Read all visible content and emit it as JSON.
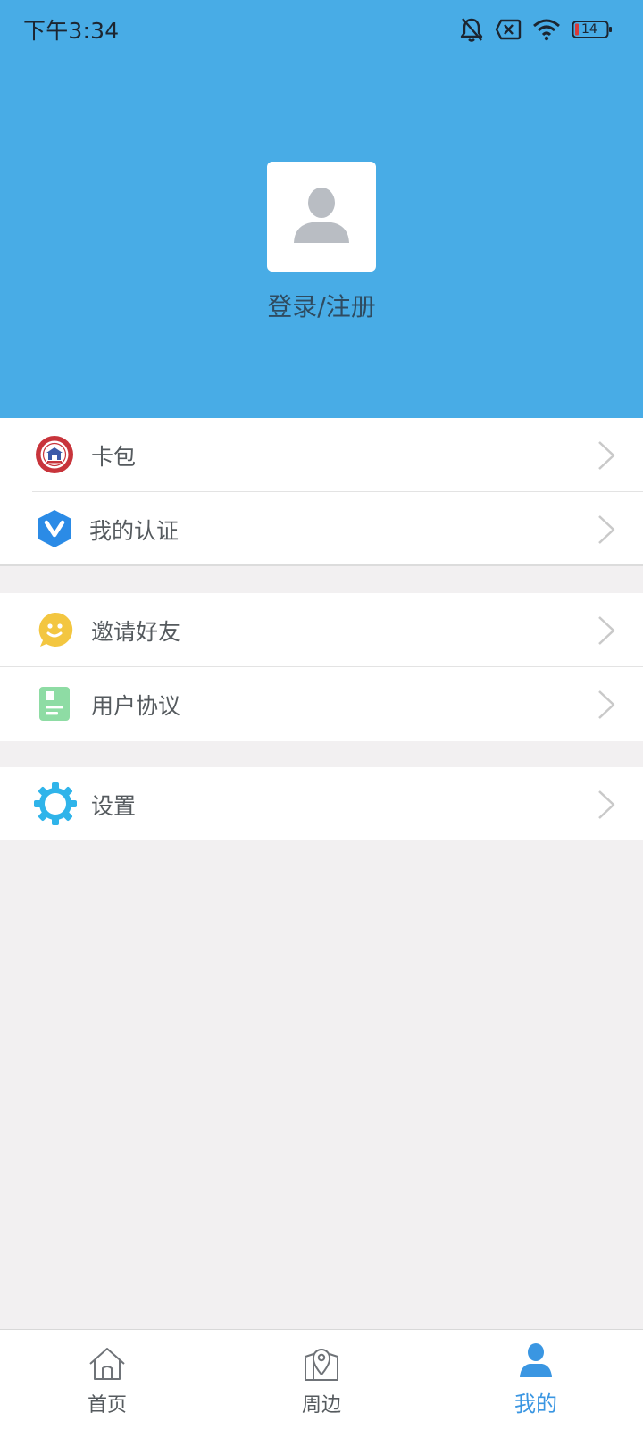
{
  "status_bar": {
    "time": "下午3:34",
    "battery_level": "14",
    "icons": [
      "bell-off-icon",
      "sim-error-icon",
      "wifi-icon",
      "battery-icon"
    ]
  },
  "profile": {
    "avatar_icon": "user-placeholder-icon",
    "login_label": "登录/注册"
  },
  "menu": {
    "group1": [
      {
        "label": "卡包",
        "icon": "card-wallet-icon"
      },
      {
        "label": "我的认证",
        "icon": "verification-v-icon"
      }
    ],
    "group2": [
      {
        "label": "邀请好友",
        "icon": "smiley-chat-icon"
      },
      {
        "label": "用户协议",
        "icon": "document-icon"
      }
    ],
    "group3": [
      {
        "label": "设置",
        "icon": "gear-icon"
      }
    ]
  },
  "bottom_nav": {
    "tabs": [
      {
        "label": "首页",
        "icon": "home-icon",
        "active": false
      },
      {
        "label": "周边",
        "icon": "map-pin-icon",
        "active": false
      },
      {
        "label": "我的",
        "icon": "user-icon",
        "active": true
      }
    ]
  },
  "colors": {
    "header_bg": "#48ace6",
    "page_bg": "#f2f0f1",
    "active_tab": "#3a96e2",
    "text": "#555a5e"
  }
}
